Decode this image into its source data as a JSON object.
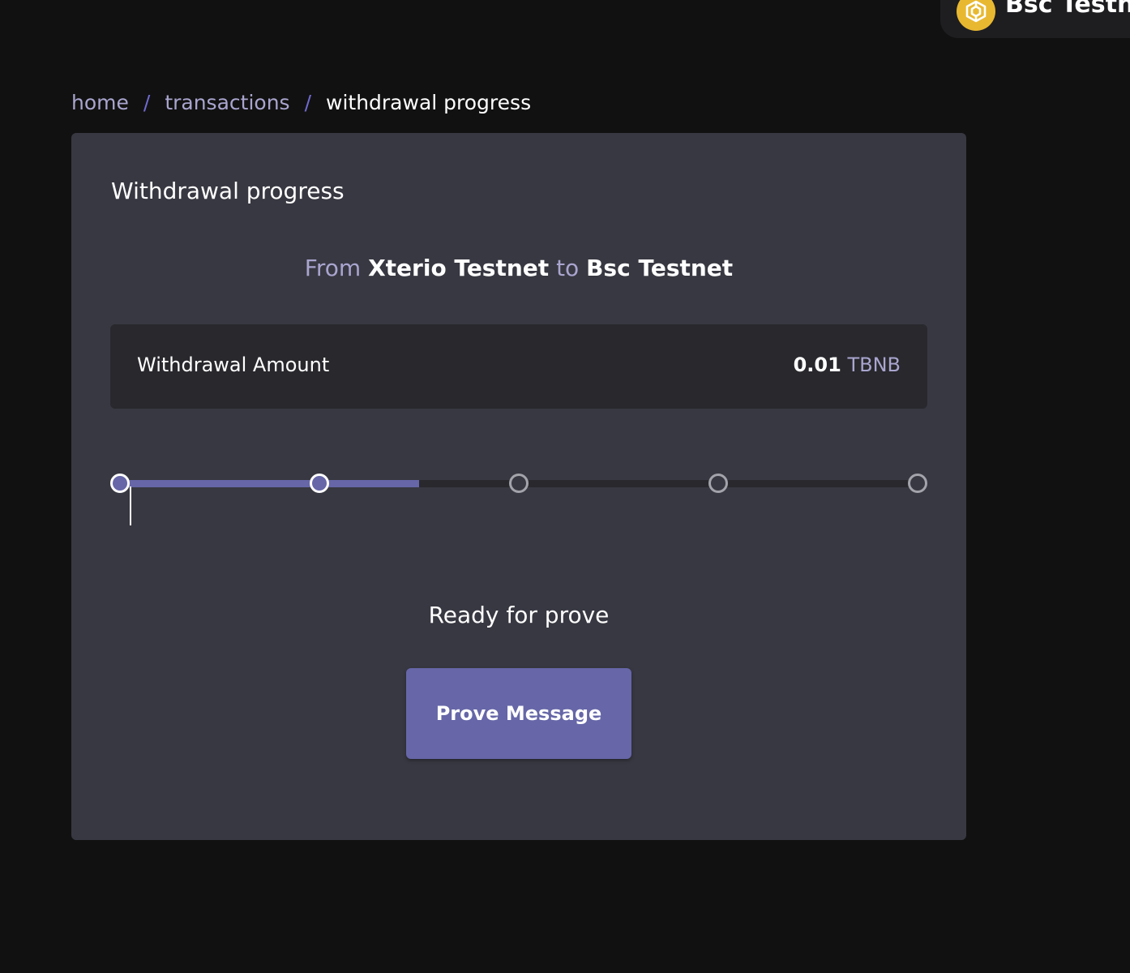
{
  "network": {
    "name": "Bsc Testnet",
    "icon": "bnb-logo-icon",
    "logo_color": "#e8b830"
  },
  "breadcrumb": {
    "items": [
      "home",
      "transactions",
      "withdrawal progress"
    ],
    "separator": "/"
  },
  "card": {
    "title": "Withdrawal progress",
    "route": {
      "from_prefix": "From",
      "from_chain": "Xterio Testnet",
      "to_word": "to",
      "to_chain": "Bsc Testnet"
    },
    "amount": {
      "label": "Withdrawal Amount",
      "value": "0.01",
      "unit": "TBNB"
    },
    "progress": {
      "total_steps": 5,
      "completed_steps": 2,
      "fill_fraction": 0.375
    },
    "status_text": "Ready for prove",
    "action_label": "Prove Message"
  },
  "colors": {
    "background": "#111111",
    "card": "#383842",
    "panel": "#28282d",
    "accent": "#6666a8",
    "muted_text": "#a9a5cf"
  }
}
